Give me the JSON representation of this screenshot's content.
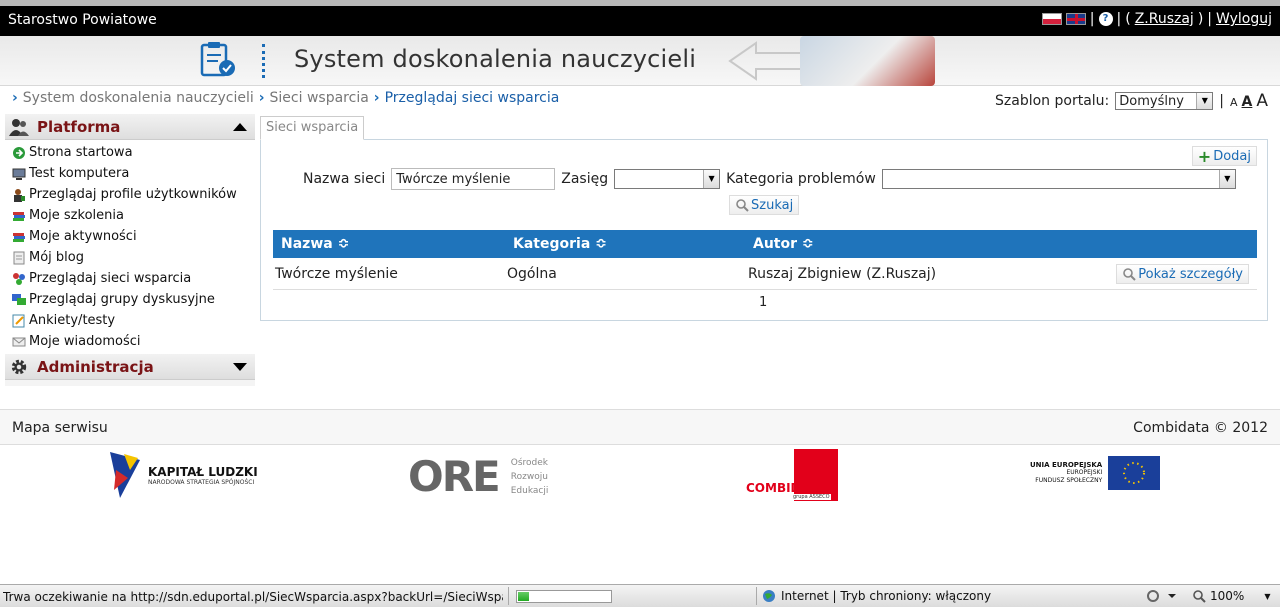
{
  "topbar": {
    "org_name": "Starostwo Powiatowe",
    "user_open": "(",
    "user_link": "Z.Ruszaj",
    "user_close": ")",
    "logout": "Wyloguj"
  },
  "banner": {
    "title": "System doskonalenia nauczycieli"
  },
  "breadcrumb": {
    "items": [
      "System doskonalenia nauczycieli",
      "Sieci wsparcia",
      "Przeglądaj sieci wsparcia"
    ]
  },
  "template": {
    "label": "Szablon portalu:",
    "selected": "Domyślny",
    "font_small": "A",
    "font_medium": "A",
    "font_large": "A"
  },
  "sidebar": {
    "platform_title": "Platforma",
    "items": [
      {
        "label": "Strona startowa",
        "icon": "home-icon"
      },
      {
        "label": "Test komputera",
        "icon": "computer-icon"
      },
      {
        "label": "Przeglądaj profile użytkowników",
        "icon": "user-profile-icon"
      },
      {
        "label": "Moje szkolenia",
        "icon": "books-icon"
      },
      {
        "label": "Moje aktywności",
        "icon": "books-icon"
      },
      {
        "label": "Mój blog",
        "icon": "blog-icon"
      },
      {
        "label": "Przeglądaj sieci wsparcia",
        "icon": "network-icon"
      },
      {
        "label": "Przeglądaj grupy dyskusyjne",
        "icon": "discussion-icon"
      },
      {
        "label": "Ankiety/testy",
        "icon": "survey-icon"
      },
      {
        "label": "Moje wiadomości",
        "icon": "mail-icon"
      }
    ],
    "admin_title": "Administracja"
  },
  "main": {
    "tab_label": "Sieci wsparcia",
    "add_label": "Dodaj",
    "filters": {
      "name_label": "Nazwa sieci",
      "name_value": "Twórcze myślenie",
      "scope_label": "Zasięg",
      "scope_value": "",
      "category_label": "Kategoria problemów",
      "category_value": ""
    },
    "search_label": "Szukaj",
    "table": {
      "columns": [
        "Nazwa",
        "Kategoria",
        "Autor"
      ],
      "sort_glyph": "≎",
      "rows": [
        {
          "name": "Twórcze myślenie",
          "category": "Ogólna",
          "author": "Ruszaj Zbigniew (Z.Ruszaj)",
          "action": "Pokaż szczegóły"
        }
      ]
    },
    "pager": "1"
  },
  "footer": {
    "sitemap": "Mapa serwisu",
    "copyright": "Combidata © 2012"
  },
  "logos": {
    "kl_title": "KAPITAŁ LUDZKI",
    "kl_sub": "NARODOWA STRATEGIA SPÓJNOŚCI",
    "ore_big": "ORE",
    "ore_l1": "Ośrodek",
    "ore_l2": "Rozwoju",
    "ore_l3": "Edukacji",
    "cd_text": "COMBIDATA",
    "cd_sub": "grupa ASSECO",
    "eu_l1": "UNIA EUROPEJSKA",
    "eu_l2": "EUROPEJSKI",
    "eu_l3": "FUNDUSZ SPOŁECZNY"
  },
  "statusbar": {
    "message": "Trwa oczekiwanie na http://sdn.eduportal.pl/SiecWsparcia.aspx?backUrl=/SieciWsparcia.aspx...",
    "progress": 0.12,
    "zone": "Internet | Tryb chroniony: włączony",
    "zoom": "100%"
  },
  "colors": {
    "header_bg": "#000000",
    "accent": "#1f74bb",
    "sidebar_title": "#7a1416"
  }
}
